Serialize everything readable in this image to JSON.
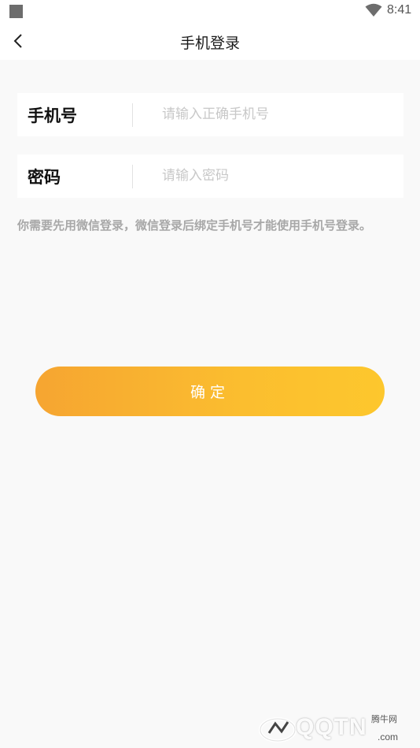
{
  "status_bar": {
    "time": "8:41",
    "icons": [
      "app-square-icon",
      "wifi-icon"
    ]
  },
  "header": {
    "back_icon": "chevron-left-icon",
    "title": "手机登录"
  },
  "phone_field": {
    "label": "手机号",
    "value": "",
    "placeholder": "请输入正确手机号"
  },
  "password_field": {
    "label": "密码",
    "value": "",
    "placeholder": "请输入密码"
  },
  "hint": "你需要先用微信登录，微信登录后绑定手机号才能使用手机号登录。",
  "confirm_button": {
    "label": "确定"
  },
  "watermark": {
    "brand": "QQTN",
    "small_text": "腾牛网",
    "suffix": ".com"
  },
  "colors": {
    "accent_start": "#f6a531",
    "accent_end": "#fdc72d",
    "background": "#f9f9f9",
    "placeholder": "#c8c8c8",
    "hint": "#a8a8a8"
  }
}
